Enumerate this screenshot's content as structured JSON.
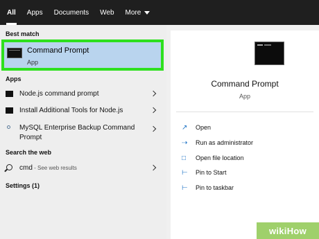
{
  "tabs": [
    "All",
    "Apps",
    "Documents",
    "Web",
    "More"
  ],
  "sections": {
    "best_match": "Best match",
    "apps": "Apps",
    "search_web": "Search the web",
    "settings": "Settings (1)"
  },
  "best_match": {
    "title": "Command Prompt",
    "subtitle": "App"
  },
  "apps": [
    {
      "label": "Node.js command prompt"
    },
    {
      "label": "Install Additional Tools for Node.js"
    },
    {
      "label_line1": "MySQL Enterprise Backup Command",
      "label_line2": "Prompt"
    }
  ],
  "web_search": {
    "query": "cmd",
    "hint": " - See web results"
  },
  "detail": {
    "title": "Command Prompt",
    "subtitle": "App",
    "actions": [
      "Open",
      "Run as administrator",
      "Open file location",
      "Pin to Start",
      "Pin to taskbar"
    ]
  },
  "watermark": "wikiHow"
}
